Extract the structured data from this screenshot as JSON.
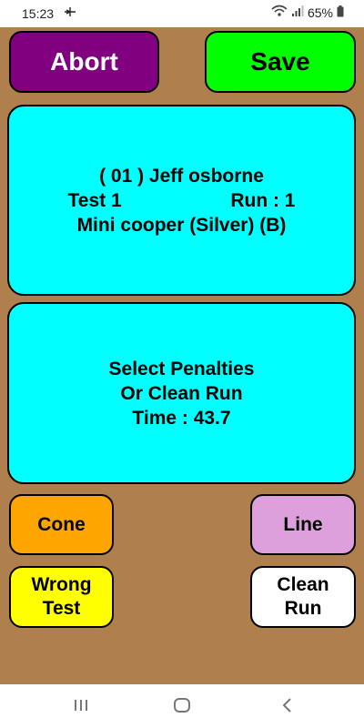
{
  "status_bar": {
    "time": "15:23",
    "battery": "65%"
  },
  "buttons": {
    "abort": "Abort",
    "save": "Save",
    "cone": "Cone",
    "line": "Line",
    "wrong_test_1": "Wrong",
    "wrong_test_2": "Test",
    "clean_run_1": "Clean",
    "clean_run_2": "Run"
  },
  "driver_panel": {
    "competitor": "( 01 ) Jeff osborne",
    "test_label": "Test  1",
    "run_label": "Run :  1",
    "car": "Mini cooper (Silver) (B)"
  },
  "penalty_panel": {
    "line1": "Select Penalties",
    "line2": "Or Clean Run",
    "time_label": "Time :  43.7"
  },
  "colors": {
    "background": "#af7f4d",
    "abort": "#800080",
    "save": "#00ff00",
    "panel": "#00ffff",
    "cone": "#ffa500",
    "line": "#dda0dd",
    "wrong_test": "#ffff00",
    "clean_run": "#ffffff"
  },
  "icons": {
    "airplane": "airplane-icon",
    "wifi": "wifi-icon",
    "signal": "signal-icon",
    "battery": "battery-icon",
    "recents": "recents-icon",
    "home": "home-icon",
    "back": "back-icon"
  }
}
